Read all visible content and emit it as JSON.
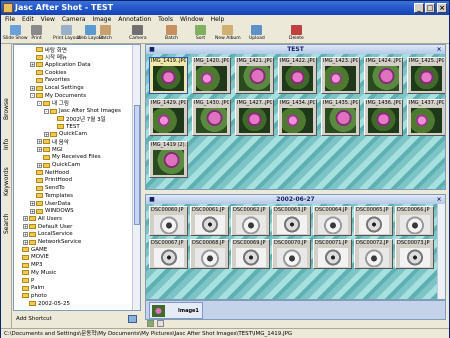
{
  "window": {
    "title": "Jasc After Shot - TEST",
    "min": "_",
    "max": "□",
    "close": "×"
  },
  "menu": [
    "File",
    "Edit",
    "View",
    "Camera",
    "Image",
    "Annotation",
    "Tools",
    "Window",
    "Help"
  ],
  "toolbar": {
    "items": [
      "Slide Show",
      "Print",
      "Print Layout",
      "Web Layout",
      "Batch",
      "Camera",
      "Batch",
      "Sort",
      "New Album",
      "Upload",
      "Delete"
    ]
  },
  "sidetabs": {
    "browse": "Browse",
    "info": "Info",
    "keywords": "Keywords",
    "search": "Search"
  },
  "tree": {
    "items": [
      {
        "label": "바탕 화면",
        "level": 2,
        "pm": ""
      },
      {
        "label": "시작 메뉴",
        "level": 2,
        "pm": ""
      },
      {
        "label": "Application Data",
        "level": 2,
        "pm": "+"
      },
      {
        "label": "Cookies",
        "level": 2,
        "pm": ""
      },
      {
        "label": "Favorites",
        "level": 2,
        "pm": ""
      },
      {
        "label": "Local Settings",
        "level": 2,
        "pm": "+"
      },
      {
        "label": "My Documents",
        "level": 2,
        "pm": "-"
      },
      {
        "label": "내 그림",
        "level": 3,
        "pm": "-"
      },
      {
        "label": "Jasc After Shot Images",
        "level": 4,
        "pm": "-"
      },
      {
        "label": "2002년 7월 3일",
        "level": 5,
        "pm": ""
      },
      {
        "label": "TEST",
        "level": 5,
        "pm": ""
      },
      {
        "label": "QuickCam",
        "level": 4,
        "pm": "+"
      },
      {
        "label": "내 음악",
        "level": 3,
        "pm": "+"
      },
      {
        "label": "MGI",
        "level": 3,
        "pm": "+"
      },
      {
        "label": "My Received Files",
        "level": 3,
        "pm": ""
      },
      {
        "label": "QuickCam",
        "level": 3,
        "pm": "+"
      },
      {
        "label": "NetHood",
        "level": 2,
        "pm": ""
      },
      {
        "label": "PrintHood",
        "level": 2,
        "pm": ""
      },
      {
        "label": "SendTo",
        "level": 2,
        "pm": ""
      },
      {
        "label": "Templates",
        "level": 2,
        "pm": ""
      },
      {
        "label": "UserData",
        "level": 2,
        "pm": "+"
      },
      {
        "label": "WINDOWS",
        "level": 2,
        "pm": "+"
      },
      {
        "label": "All Users",
        "level": 1,
        "pm": "+"
      },
      {
        "label": "Default User",
        "level": 1,
        "pm": "+"
      },
      {
        "label": "LocalService",
        "level": 1,
        "pm": "+"
      },
      {
        "label": "NetworkService",
        "level": 1,
        "pm": "+"
      },
      {
        "label": "GAME",
        "level": 0,
        "pm": ""
      },
      {
        "label": "MOVIE",
        "level": 0,
        "pm": ""
      },
      {
        "label": "MP3",
        "level": 0,
        "pm": ""
      },
      {
        "label": "My Music",
        "level": 0,
        "pm": ""
      },
      {
        "label": "P",
        "level": 0,
        "pm": ""
      },
      {
        "label": "Palm",
        "level": 0,
        "pm": ""
      },
      {
        "label": "photo",
        "level": 0,
        "pm": ""
      },
      {
        "label": "2002-05-25",
        "level": 1,
        "pm": ""
      }
    ]
  },
  "add_shortcut": "Add Shortcut",
  "top_panel": {
    "title": "TEST",
    "thumbnails": [
      "IMG_1419..JPG",
      "IMG_1420..JPG",
      "IMG_1421..JPG",
      "IMG_1422..JPG",
      "IMG_1423..JPG",
      "IMG_1424..JPG",
      "IMG_1425..JPG",
      "IMG_1429..JPG",
      "IMG_1430..JPG",
      "IMG_1427..JPG",
      "IMG_1434..JPG",
      "IMG_1435..JPG",
      "IMG_1436..JPG",
      "IMG_1437..JPG",
      "IMG_1419 (2)..."
    ]
  },
  "bottom_panel": {
    "title": "2002-06-27",
    "thumbnails": [
      "DSC00060.JP",
      "DSC00061.JP",
      "DSC00062.JP",
      "DSC00063.JP",
      "DSC00064.JP",
      "DSC00065.JP",
      "DSC00066.JP",
      "DSC00067.JP",
      "DSC00068.JP",
      "DSC00069.JP",
      "DSC00070.JP",
      "DSC00071.JP",
      "DSC00072.JP",
      "DSC00073.JP"
    ]
  },
  "tray": {
    "item_label": "Image1"
  },
  "status": "C:\\Documents and Settings\\문동혁\\My Documents\\My Pictures\\Jasc After Shot Images\\TEST\\IMG_1419.JPG",
  "colors": {
    "title_bar": "#1041b8",
    "panel_bg": "#7cc4c6",
    "selected": "#f0e8a8"
  }
}
